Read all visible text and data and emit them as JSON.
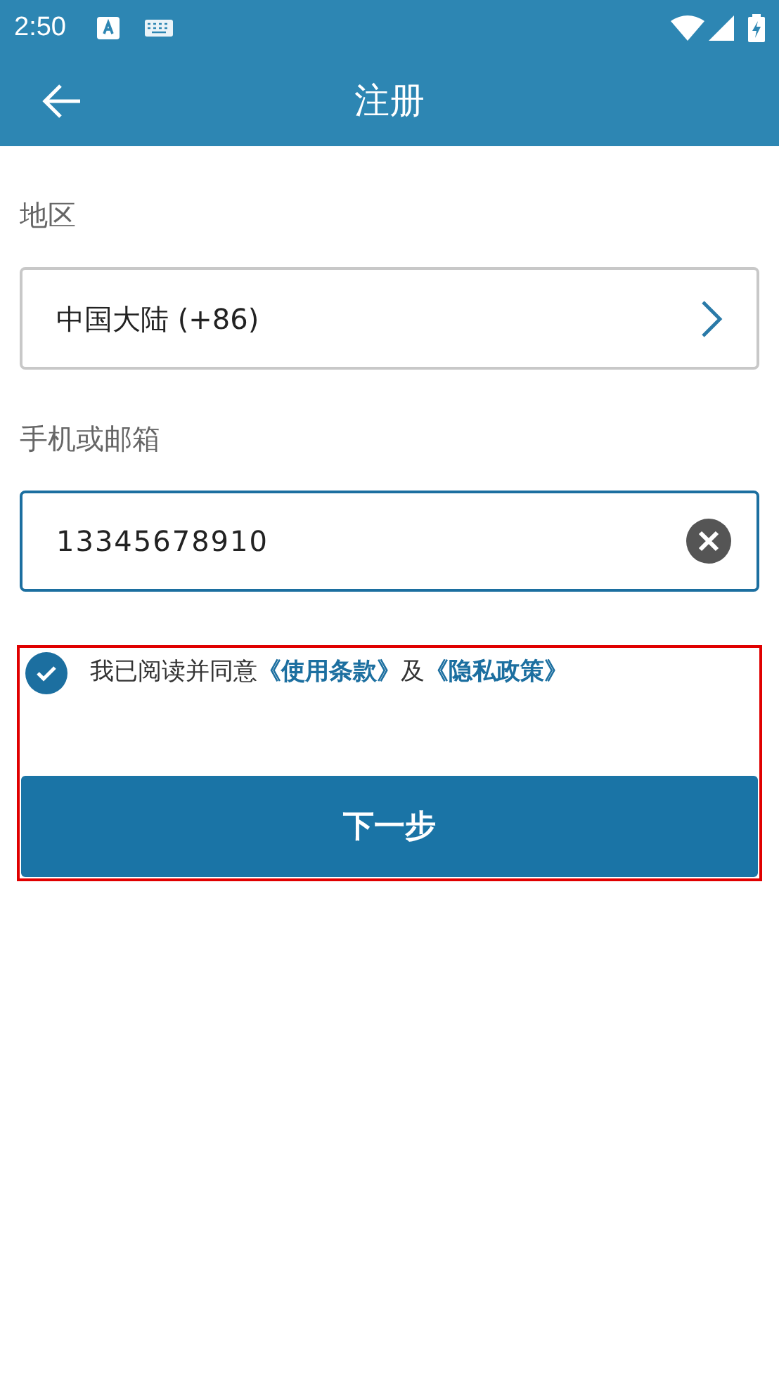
{
  "status_bar": {
    "time": "2:50"
  },
  "app_bar": {
    "title": "注册"
  },
  "region": {
    "label": "地区",
    "value": "中国大陆 (+86)"
  },
  "account": {
    "label": "手机或邮箱",
    "value": "13345678910",
    "focused": true
  },
  "agreement": {
    "checked": true,
    "highlighted": true,
    "parts": [
      {
        "kind": "text",
        "text": "我已阅读并同意"
      },
      {
        "kind": "link",
        "text": "《使用条款》"
      },
      {
        "kind": "text",
        "text": "及"
      },
      {
        "kind": "link",
        "text": "《隐私政策》"
      }
    ]
  },
  "next_button": {
    "label": "下一步"
  }
}
